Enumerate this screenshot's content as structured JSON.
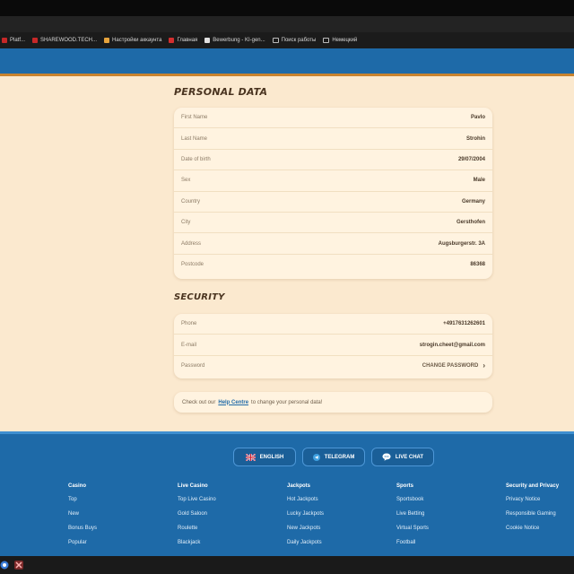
{
  "bookmarks": [
    {
      "label": "Platf...",
      "icon": "site-icon",
      "color": "#c62828"
    },
    {
      "label": "SHAREWOOD.TECH...",
      "icon": "site-icon",
      "color": "#c62828"
    },
    {
      "label": "Настройки аккаунта",
      "icon": "site-icon",
      "color": "#e5a33d"
    },
    {
      "label": "Главная",
      "icon": "site-icon",
      "color": "#d32f2f"
    },
    {
      "label": "Bewerbung - KI-gen...",
      "icon": "site-icon",
      "color": "#e0e0e0"
    },
    {
      "label": "Поиск работы",
      "icon": "folder-icon",
      "color": ""
    },
    {
      "label": "Немецкий",
      "icon": "folder-icon",
      "color": ""
    }
  ],
  "personal": {
    "title": "PERSONAL DATA",
    "rows": [
      {
        "label": "First Name",
        "value": "Pavlo"
      },
      {
        "label": "Last Name",
        "value": "Strohin"
      },
      {
        "label": "Date of birth",
        "value": "29/07/2004"
      },
      {
        "label": "Sex",
        "value": "Male"
      },
      {
        "label": "Country",
        "value": "Germany"
      },
      {
        "label": "City",
        "value": "Gersthofen"
      },
      {
        "label": "Address",
        "value": "Augsburgerstr. 3A"
      },
      {
        "label": "Postcode",
        "value": "86368"
      }
    ]
  },
  "security": {
    "title": "SECURITY",
    "phone_label": "Phone",
    "phone_value": "+4917631262601",
    "email_label": "E-mail",
    "email_value": "strogin.cheet@gmail.com",
    "password_label": "Password",
    "password_action": "CHANGE PASSWORD"
  },
  "note": {
    "before": "Check out our",
    "link": "Help Centre",
    "after": "to change your personal data!"
  },
  "footer": {
    "buttons": [
      {
        "label": "ENGLISH",
        "icon": "uk-flag-icon"
      },
      {
        "label": "TELEGRAM",
        "icon": "telegram-icon"
      },
      {
        "label": "LIVE CHAT",
        "icon": "chat-bubble-icon"
      }
    ],
    "columns": [
      {
        "heading": "Casino",
        "links": [
          "Top",
          "New",
          "Bonus Buys",
          "Popular"
        ]
      },
      {
        "heading": "Live Casino",
        "links": [
          "Top Live Casino",
          "Gold Saloon",
          "Roulette",
          "Blackjack"
        ]
      },
      {
        "heading": "Jackpots",
        "links": [
          "Hot Jackpots",
          "Lucky Jackpots",
          "New Jackpots",
          "Daily Jackpots"
        ]
      },
      {
        "heading": "Sports",
        "links": [
          "Sportsbook",
          "Live Betting",
          "Virtual Sports",
          "Football"
        ]
      },
      {
        "heading": "Security and Privacy",
        "links": [
          "Privacy Notice",
          "Responsible Gaming",
          "Cookie Notice"
        ]
      }
    ]
  },
  "colors": {
    "header_blue": "#1e6aa8",
    "page_bg": "#fbe9cf",
    "card_bg": "#fff3e0",
    "accent_orange": "#c8832f"
  }
}
